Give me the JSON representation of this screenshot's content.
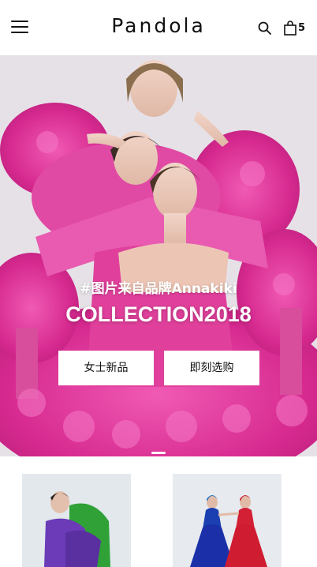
{
  "header": {
    "brand": "Pandola",
    "cart_count": "5",
    "icons": [
      "menu-icon",
      "search-icon",
      "shopping-bag-icon"
    ]
  },
  "hero": {
    "tag": "#图片来自品牌Annakiki",
    "title": "COLLECTION2018",
    "button_women": "女士新品",
    "button_shop": "即刻选购",
    "slide_indicator_active": 1
  },
  "colors": {
    "accent_pink": "#e0399e",
    "background": "#ffffff",
    "text": "#111111"
  }
}
